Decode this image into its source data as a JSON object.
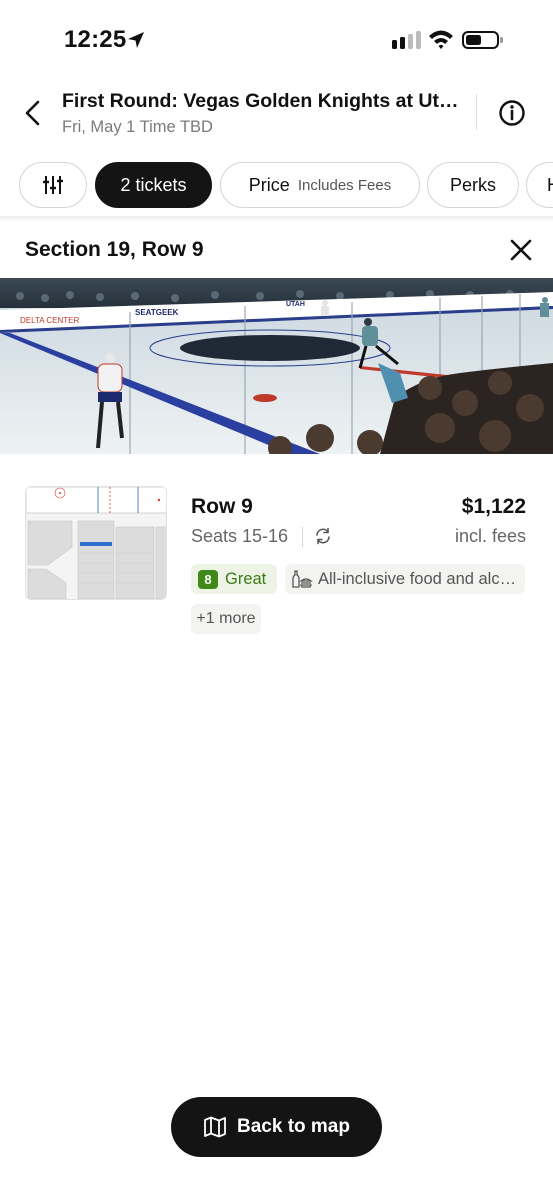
{
  "status": {
    "time": "12:25"
  },
  "header": {
    "title": "First Round: Vegas Golden Knights at Utah Mammoth",
    "subtitle": "Fri, May 1 Time TBD"
  },
  "filters": {
    "tickets_label": "2 tickets",
    "price_label": "Price",
    "price_note": "Includes Fees",
    "perks_label": "Perks",
    "next_label": "H"
  },
  "section": {
    "title": "Section 19, Row 9"
  },
  "rink_photo": {
    "board_text": "DELTA CENTER",
    "sponsor": "SEATGEEK",
    "team_text": "UTAH"
  },
  "listing": {
    "row": "Row 9",
    "price": "$1,122",
    "seats": "Seats 15-16",
    "fees_note": "incl. fees",
    "deal_score": "8",
    "deal_label": "Great",
    "perk": "All-inclusive food and alcohol",
    "more": "+1 more"
  },
  "bottom": {
    "back_to_map": "Back to map"
  },
  "colors": {
    "dark": "#141414",
    "great_green": "#3d8a1a",
    "muted_text": "#666666"
  }
}
